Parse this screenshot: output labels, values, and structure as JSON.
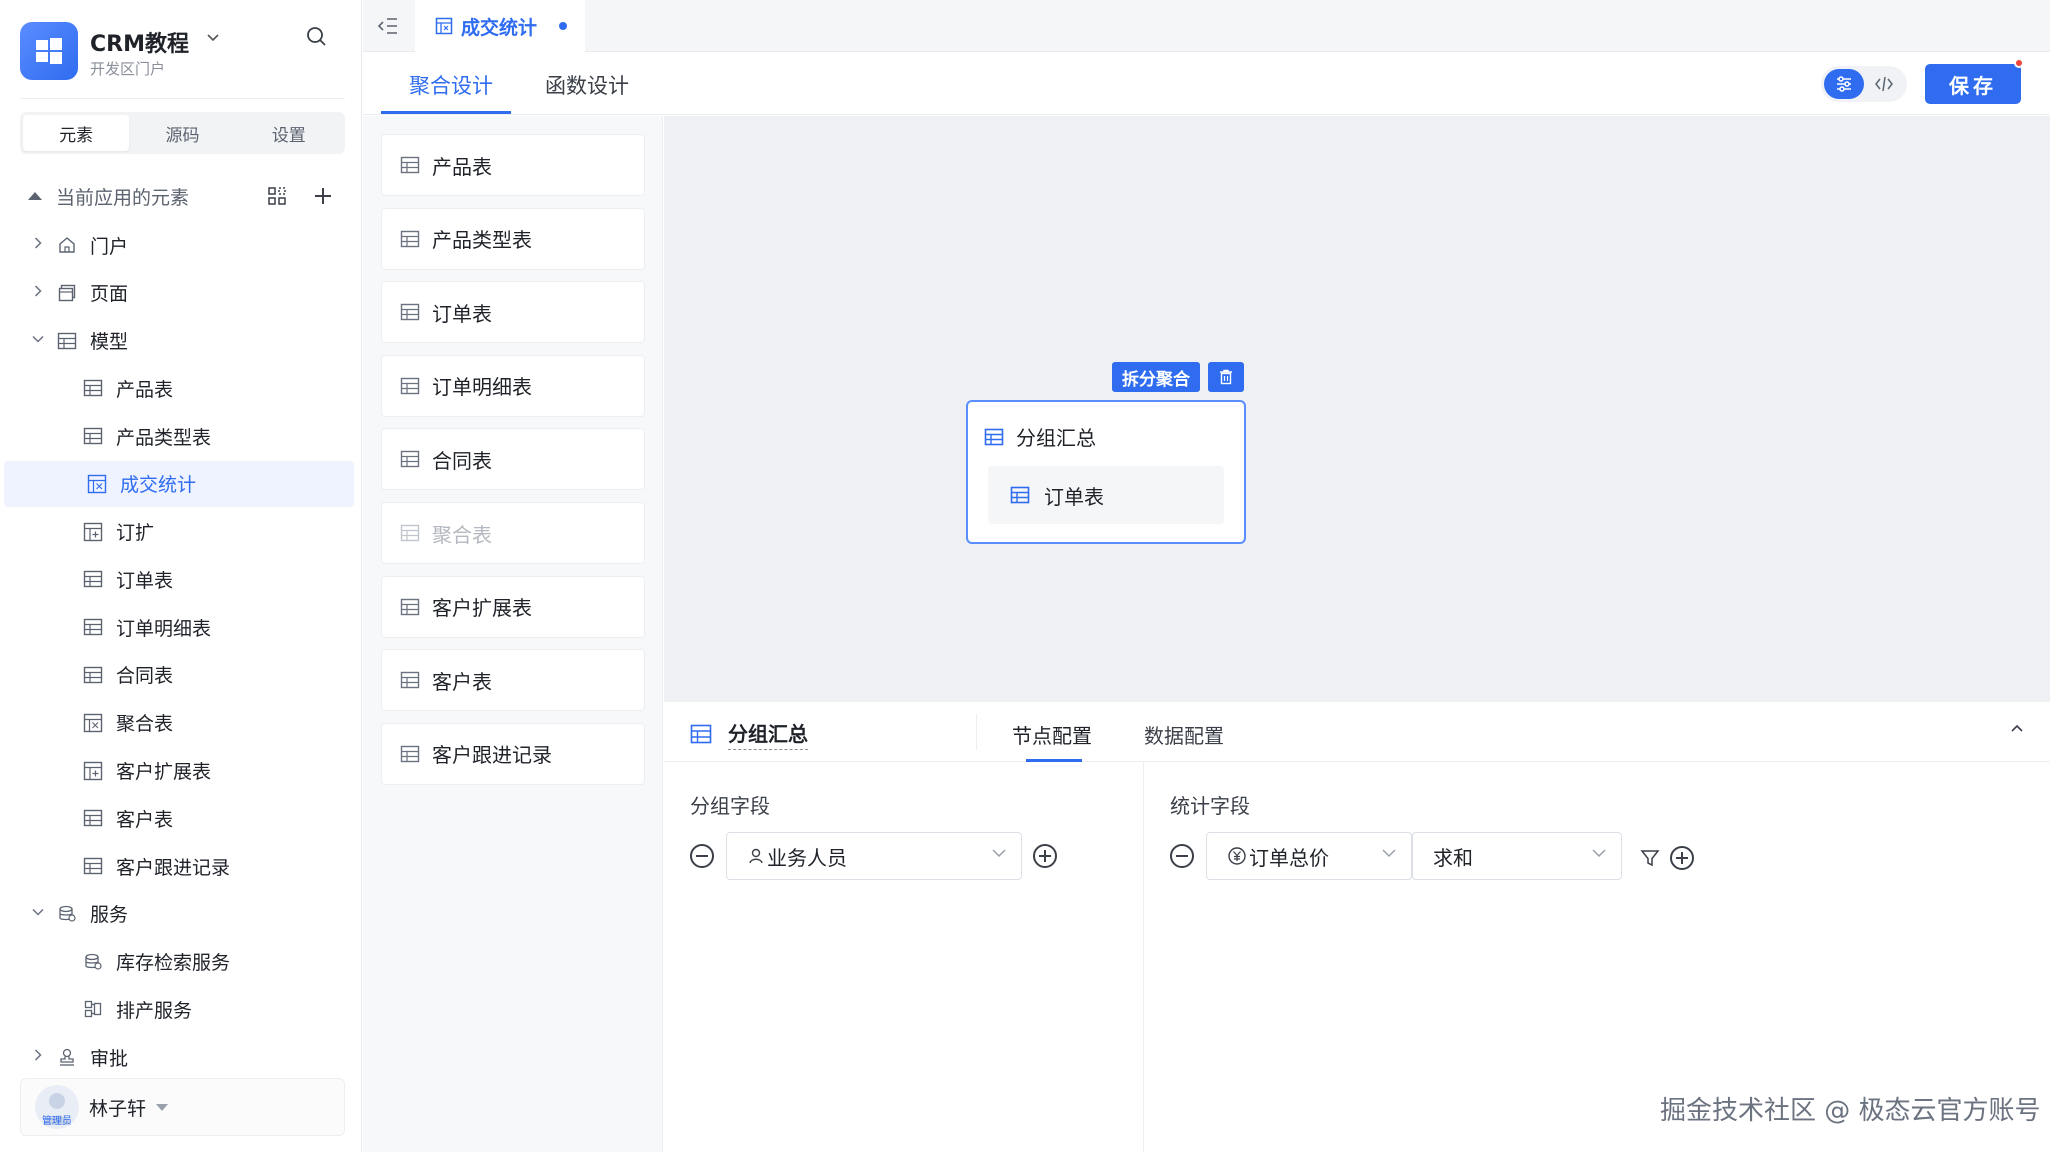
{
  "app": {
    "name": "CRM教程",
    "subtitle": "开发区门户"
  },
  "sidebar": {
    "segments": [
      "元素",
      "源码",
      "设置"
    ],
    "section_title": "当前应用的元素",
    "tree": [
      {
        "label": "门户",
        "level": 0,
        "arrow": "right",
        "icon": "home-icon"
      },
      {
        "label": "页面",
        "level": 0,
        "arrow": "right",
        "icon": "page-icon"
      },
      {
        "label": "模型",
        "level": 0,
        "arrow": "down",
        "icon": "table-icon"
      },
      {
        "label": "产品表",
        "level": 1,
        "icon": "table-icon"
      },
      {
        "label": "产品类型表",
        "level": 1,
        "icon": "table-icon"
      },
      {
        "label": "成交统计",
        "level": 1,
        "icon": "aggregate-icon",
        "selected": true
      },
      {
        "label": "订扩",
        "level": 1,
        "icon": "extend-table-icon"
      },
      {
        "label": "订单表",
        "level": 1,
        "icon": "table-icon"
      },
      {
        "label": "订单明细表",
        "level": 1,
        "icon": "table-icon"
      },
      {
        "label": "合同表",
        "level": 1,
        "icon": "table-icon"
      },
      {
        "label": "聚合表",
        "level": 1,
        "icon": "aggregate-icon"
      },
      {
        "label": "客户扩展表",
        "level": 1,
        "icon": "extend-table-icon"
      },
      {
        "label": "客户表",
        "level": 1,
        "icon": "table-icon"
      },
      {
        "label": "客户跟进记录",
        "level": 1,
        "icon": "table-icon"
      },
      {
        "label": "服务",
        "level": 0,
        "arrow": "down",
        "icon": "service-icon"
      },
      {
        "label": "库存检索服务",
        "level": 1,
        "icon": "service-icon"
      },
      {
        "label": "排产服务",
        "level": 1,
        "icon": "schedule-icon"
      },
      {
        "label": "审批",
        "level": 0,
        "arrow": "right",
        "icon": "approval-icon"
      }
    ],
    "user": {
      "name": "林子轩",
      "role": "管理员"
    }
  },
  "tabbar": {
    "active_tab": "成交统计"
  },
  "design": {
    "tabs": [
      "聚合设计",
      "函数设计"
    ],
    "save_label": "保存"
  },
  "table_list": [
    {
      "label": "产品表",
      "disabled": false
    },
    {
      "label": "产品类型表",
      "disabled": false
    },
    {
      "label": "订单表",
      "disabled": false
    },
    {
      "label": "订单明细表",
      "disabled": false
    },
    {
      "label": "合同表",
      "disabled": false
    },
    {
      "label": "聚合表",
      "disabled": true
    },
    {
      "label": "客户扩展表",
      "disabled": false
    },
    {
      "label": "客户表",
      "disabled": false
    },
    {
      "label": "客户跟进记录",
      "disabled": false
    }
  ],
  "canvas": {
    "split_label": "拆分聚合",
    "node_title": "分组汇总",
    "node_child": "订单表"
  },
  "config": {
    "title": "分组汇总",
    "tabs": [
      "节点配置",
      "数据配置"
    ],
    "group_label": "分组字段",
    "group_field": "业务人员",
    "stat_label": "统计字段",
    "stat_field": "订单总价",
    "stat_func": "求和"
  },
  "watermark": "掘金技术社区 @ 极态云官方账号",
  "colors": {
    "accent": "#2f6cf0",
    "canvas_bg": "#eef0f4",
    "badge_red": "#f04438"
  }
}
